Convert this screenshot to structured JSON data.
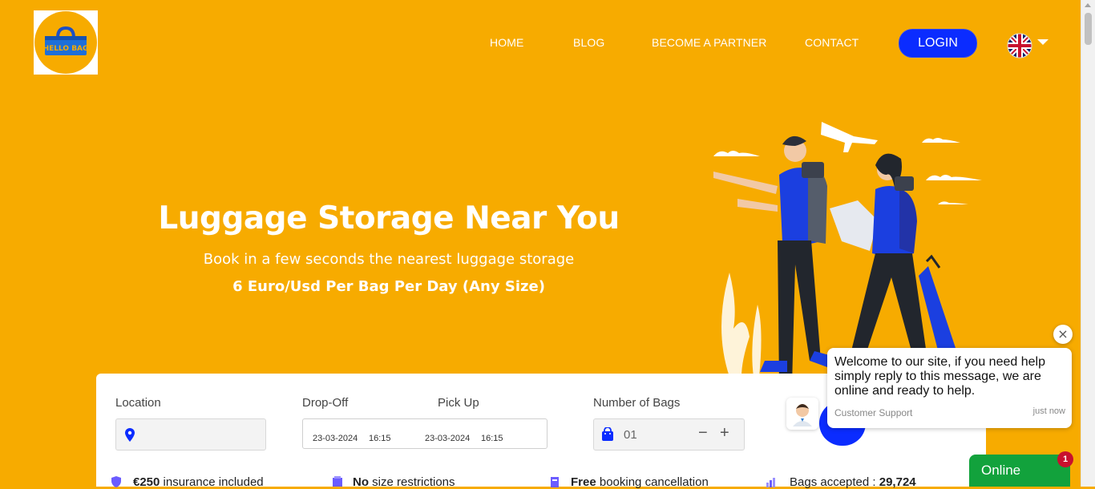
{
  "header": {
    "logo_text": "HELLO BAG",
    "nav": [
      {
        "label": "HOME"
      },
      {
        "label": "BLOG"
      },
      {
        "label": "BECOME A PARTNER"
      },
      {
        "label": "CONTACT"
      }
    ],
    "login_label": "LOGIN",
    "language_icon": "uk-flag-icon"
  },
  "hero": {
    "title": "Luggage Storage Near You",
    "subtitle": "Book in a few seconds the nearest luggage storage",
    "price": "6 Euro/Usd Per Bag Per Day (Any Size)"
  },
  "booking": {
    "location_label": "Location",
    "location_value": "",
    "dropoff_label": "Drop-Off",
    "pickup_label": "Pick Up",
    "dropoff_date": "23-03-2024",
    "dropoff_time": "16:15",
    "pickup_date": "23-03-2024",
    "pickup_time": "16:15",
    "bags_label": "Number of Bags",
    "bags_value": "01",
    "minus": "−",
    "plus": "+"
  },
  "features": [
    {
      "bold": "€250",
      "text": " insurance included"
    },
    {
      "bold": "No",
      "text": " size restrictions"
    },
    {
      "bold": "Free",
      "text": " booking cancellation"
    },
    {
      "text": "Bags accepted : ",
      "bold": "29,724"
    }
  ],
  "chat": {
    "message": "Welcome to our site, if you need help simply reply to this message, we are online and ready to help.",
    "from": "Customer Support",
    "time": "just now",
    "close": "×",
    "status": "Online",
    "badge": "1"
  },
  "colors": {
    "background": "#F7AB00",
    "accent": "#0b2cff",
    "online": "#12a23c"
  }
}
